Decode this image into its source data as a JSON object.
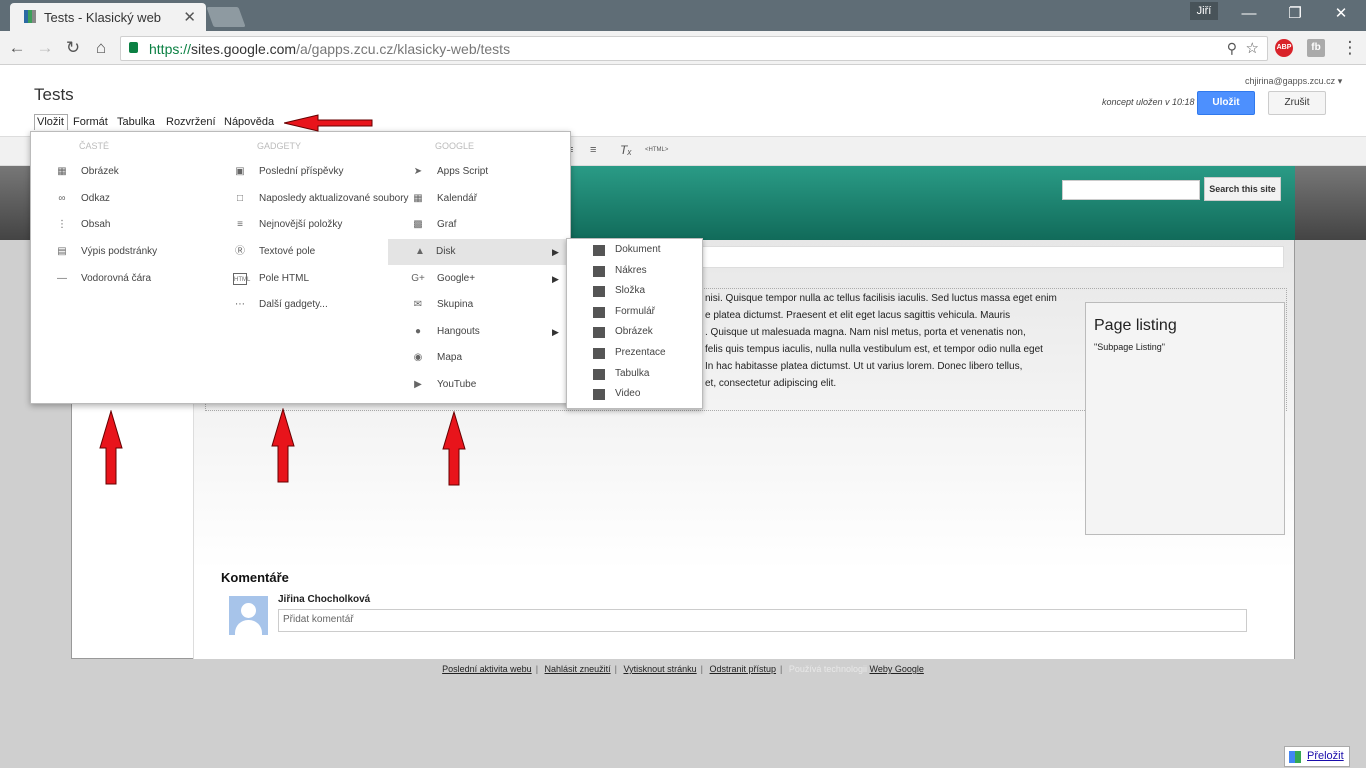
{
  "browser": {
    "tab_title": "Tests - Klasický web",
    "tab_close": "✕",
    "window_user": "Jiří",
    "url_scheme": "https://",
    "url_host": "sites.google.com",
    "url_path": "/a/gapps.zcu.cz/klasicky-web/tests",
    "ext_abp": "ABP",
    "ext_fb": "fb"
  },
  "editor": {
    "page_title": "Tests",
    "account": "chjirina@gapps.zcu.cz",
    "draft_status": "koncept uložen v 10:18",
    "save_label": "Uložit",
    "cancel_label": "Zrušit",
    "menus": [
      "Vložit",
      "Formát",
      "Tabulka",
      "Rozvržení",
      "Nápověda"
    ],
    "html_label": "<HTML>"
  },
  "insert_menu": {
    "headers": [
      "ČASTÉ",
      "GADGETY",
      "GOOGLE"
    ],
    "common": [
      {
        "label": "Obrázek",
        "icon": "image-icon"
      },
      {
        "label": "Odkaz",
        "icon": "link-icon"
      },
      {
        "label": "Obsah",
        "icon": "toc-icon"
      },
      {
        "label": "Výpis podstránky",
        "icon": "subpage-listing-icon"
      },
      {
        "label": "Vodorovná čára",
        "icon": "horizontal-line-icon"
      }
    ],
    "gadgets": [
      {
        "label": "Poslední příspěvky",
        "icon": "recent-posts-icon"
      },
      {
        "label": "Naposledy aktualizované soubory",
        "icon": "recent-files-icon"
      },
      {
        "label": "Nejnovější položky",
        "icon": "recent-items-icon"
      },
      {
        "label": "Textové pole",
        "icon": "text-box-icon"
      },
      {
        "label": "Pole HTML",
        "icon": "html-box-icon"
      },
      {
        "label": "Další gadgety...",
        "icon": "more-gadgets-icon"
      }
    ],
    "google": [
      {
        "label": "Apps Script",
        "icon": "apps-script-icon"
      },
      {
        "label": "Kalendář",
        "icon": "calendar-icon"
      },
      {
        "label": "Graf",
        "icon": "chart-icon"
      },
      {
        "label": "Disk",
        "icon": "drive-icon"
      },
      {
        "label": "Google+",
        "icon": "google-plus-icon"
      },
      {
        "label": "Skupina",
        "icon": "group-icon"
      },
      {
        "label": "Hangouts",
        "icon": "hangouts-icon"
      },
      {
        "label": "Mapa",
        "icon": "map-icon"
      },
      {
        "label": "YouTube",
        "icon": "youtube-icon"
      }
    ],
    "submenu_arrow": "▶"
  },
  "disk_submenu": [
    {
      "label": "Dokument",
      "icon": "document-icon"
    },
    {
      "label": "Nákres",
      "icon": "drawing-icon"
    },
    {
      "label": "Složka",
      "icon": "folder-icon"
    },
    {
      "label": "Formulář",
      "icon": "form-icon"
    },
    {
      "label": "Obrázek",
      "icon": "image-icon"
    },
    {
      "label": "Prezentace",
      "icon": "presentation-icon"
    },
    {
      "label": "Tabulka",
      "icon": "spreadsheet-icon"
    },
    {
      "label": "Video",
      "icon": "video-icon"
    }
  ],
  "site": {
    "search_button": "Search this site",
    "text_lines": [
      "nisi. Quisque tempor nulla ac tellus facilisis iaculis. Sed luctus massa eget enim",
      "e platea dictumst. Praesent et elit eget lacus sagittis vehicula. Mauris",
      ". Quisque ut malesuada magna. Nam nisl metus, porta et venenatis non,",
      "felis quis tempus iaculis, nulla nulla vestibulum est, et tempor odio nulla eget",
      "In hac habitasse platea dictumst. Ut ut varius lorem. Donec libero tellus,",
      "et, consectetur adipiscing elit."
    ],
    "page_listing_title": "Page listing",
    "page_listing_sub": "\"Subpage Listing\"",
    "comments_heading": "Komentáře",
    "commenter": "Jiřina Chocholková",
    "comment_placeholder": "Přidat komentář"
  },
  "footer": {
    "links": [
      "Poslední aktivita webu",
      "Nahlásit zneužití",
      "Vytisknout stránku",
      "Odstranit přístup"
    ],
    "powered": "Používá technologii",
    "google_sites": "Weby Google",
    "translate": "Přeložit"
  },
  "colors": {
    "annotation_arrow": "#e8141b",
    "primary_button": "#4d90fe",
    "site_header": "#1f8a75"
  }
}
